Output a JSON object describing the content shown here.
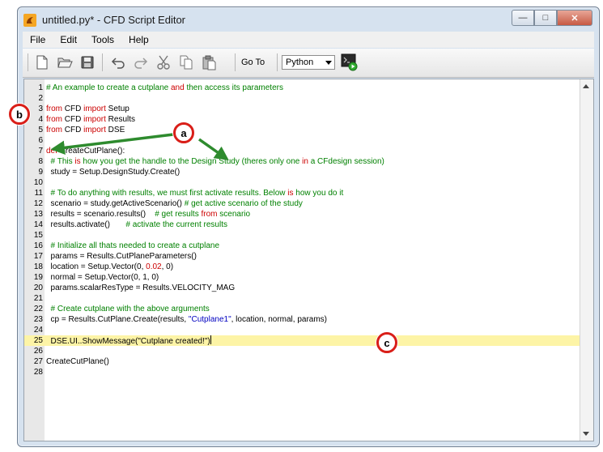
{
  "window": {
    "title": "untitled.py* - CFD Script Editor",
    "controls": {
      "minimize": "—",
      "maximize": "□",
      "close": "✕"
    }
  },
  "menu": [
    "File",
    "Edit",
    "Tools",
    "Help"
  ],
  "toolbar": {
    "icons": [
      "new-file-icon",
      "open-folder-icon",
      "save-icon",
      "undo-icon",
      "redo-icon",
      "cut-icon",
      "copy-icon",
      "paste-icon"
    ],
    "goto_label": "Go To",
    "language": "Python",
    "run_icon": "run-script-icon"
  },
  "editor": {
    "lines": [
      {
        "n": "1",
        "segs": [
          {
            "t": "# An example to create a cutplane ",
            "c": "c"
          },
          {
            "t": "and",
            "c": "k"
          },
          {
            "t": " then access its parameters",
            "c": "c"
          }
        ]
      },
      {
        "n": "2",
        "segs": []
      },
      {
        "n": "3",
        "segs": [
          {
            "t": "from",
            "c": "k"
          },
          {
            "t": " CFD ",
            "c": "n"
          },
          {
            "t": "import",
            "c": "k"
          },
          {
            "t": " Setup",
            "c": "n"
          }
        ]
      },
      {
        "n": "4",
        "segs": [
          {
            "t": "from",
            "c": "k"
          },
          {
            "t": " CFD ",
            "c": "n"
          },
          {
            "t": "import",
            "c": "k"
          },
          {
            "t": " Results",
            "c": "n"
          }
        ]
      },
      {
        "n": "5",
        "segs": [
          {
            "t": "from",
            "c": "k"
          },
          {
            "t": " CFD ",
            "c": "n"
          },
          {
            "t": "import",
            "c": "k"
          },
          {
            "t": " DSE",
            "c": "n"
          }
        ]
      },
      {
        "n": "6",
        "segs": []
      },
      {
        "n": "7",
        "segs": [
          {
            "t": "def",
            "c": "k"
          },
          {
            "t": " CreateCutPlane():",
            "c": "n"
          }
        ]
      },
      {
        "n": "8",
        "segs": [
          {
            "t": "  # This ",
            "c": "c"
          },
          {
            "t": "is",
            "c": "k"
          },
          {
            "t": " how you get the handle to the Design Study (theres only one ",
            "c": "c"
          },
          {
            "t": "in",
            "c": "k"
          },
          {
            "t": " a CFdesign session)",
            "c": "c"
          }
        ]
      },
      {
        "n": "9",
        "segs": [
          {
            "t": "  study = Setup.DesignStudy.Create()",
            "c": "n"
          }
        ]
      },
      {
        "n": "10",
        "segs": []
      },
      {
        "n": "11",
        "segs": [
          {
            "t": "  # To do anything with results, we must first activate results. Below ",
            "c": "c"
          },
          {
            "t": "is",
            "c": "k"
          },
          {
            "t": " how you do it",
            "c": "c"
          }
        ]
      },
      {
        "n": "12",
        "segs": [
          {
            "t": "  scenario = study.getActiveScenario() ",
            "c": "n"
          },
          {
            "t": "# get active scenario of the study",
            "c": "c"
          }
        ]
      },
      {
        "n": "13",
        "segs": [
          {
            "t": "  results = scenario.results()    ",
            "c": "n"
          },
          {
            "t": "# get results ",
            "c": "c"
          },
          {
            "t": "from",
            "c": "k"
          },
          {
            "t": " scenario",
            "c": "c"
          }
        ]
      },
      {
        "n": "14",
        "segs": [
          {
            "t": "  results.activate()       ",
            "c": "n"
          },
          {
            "t": "# activate the current results",
            "c": "c"
          }
        ]
      },
      {
        "n": "15",
        "segs": []
      },
      {
        "n": "16",
        "segs": [
          {
            "t": "  # Initialize all thats needed to create a cutplane",
            "c": "c"
          }
        ]
      },
      {
        "n": "17",
        "segs": [
          {
            "t": "  params = Results.CutPlaneParameters()",
            "c": "n"
          }
        ]
      },
      {
        "n": "18",
        "segs": [
          {
            "t": "  location = Setup.Vector(0, ",
            "c": "n"
          },
          {
            "t": "0.02",
            "c": "k"
          },
          {
            "t": ", 0)",
            "c": "n"
          }
        ]
      },
      {
        "n": "19",
        "segs": [
          {
            "t": "  normal = Setup.Vector(0, 1, 0)",
            "c": "n"
          }
        ]
      },
      {
        "n": "20",
        "segs": [
          {
            "t": "  params.scalarResType = Results.VELOCITY_MAG",
            "c": "n"
          }
        ]
      },
      {
        "n": "21",
        "segs": []
      },
      {
        "n": "22",
        "segs": [
          {
            "t": "  # Create cutplane with the above arguments",
            "c": "c"
          }
        ]
      },
      {
        "n": "23",
        "segs": [
          {
            "t": "  cp = Results.CutPlane.Create(results, ",
            "c": "n"
          },
          {
            "t": "\"Cutplane1\"",
            "c": "s"
          },
          {
            "t": ", location, normal, params)",
            "c": "n"
          }
        ]
      },
      {
        "n": "24",
        "segs": []
      },
      {
        "n": "25",
        "segs": [
          {
            "t": "  DSE.UI..ShowMessage(\"Cutplane created!\")",
            "c": "n"
          }
        ],
        "highlight": true
      },
      {
        "n": "26",
        "segs": []
      },
      {
        "n": "27",
        "segs": [
          {
            "t": "CreateCutPlane()",
            "c": "n"
          }
        ]
      },
      {
        "n": "28",
        "segs": []
      }
    ]
  },
  "callouts": {
    "a": "a",
    "b": "b",
    "c": "c"
  },
  "colors": {
    "comment": "#008000",
    "keyword": "#cc0000",
    "string": "#0000c0",
    "highlight": "#fdf4a6",
    "callout_border": "#d91e18",
    "arrow": "#2e8b2e"
  }
}
